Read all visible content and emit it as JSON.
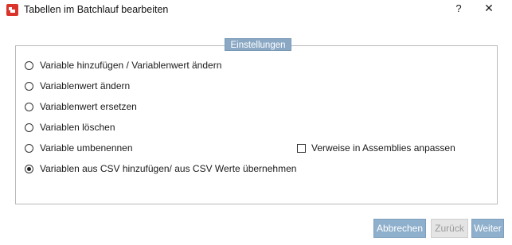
{
  "window": {
    "title": "Tabellen im Batchlauf bearbeiten",
    "help_label": "?",
    "close_label": "✕"
  },
  "group": {
    "title": "Einstellungen",
    "options": [
      {
        "label": "Variable hinzufügen / Variablenwert ändern",
        "checked": false
      },
      {
        "label": "Variablenwert ändern",
        "checked": false
      },
      {
        "label": "Variablenwert ersetzen",
        "checked": false
      },
      {
        "label": "Variablen löschen",
        "checked": false
      },
      {
        "label": "Variable umbenennen",
        "checked": false
      },
      {
        "label": "Variablen aus CSV hinzufügen/ aus CSV Werte übernehmen",
        "checked": true
      }
    ],
    "checkbox": {
      "label": "Verweise in Assemblies anpassen",
      "checked": false
    }
  },
  "buttons": {
    "cancel": "Abbrechen",
    "back": "Zurück",
    "next": "Weiter"
  },
  "colors": {
    "accent": "#8fb0cc",
    "group_title_bg": "#8aa8c4",
    "app_icon": "#d9332b"
  }
}
